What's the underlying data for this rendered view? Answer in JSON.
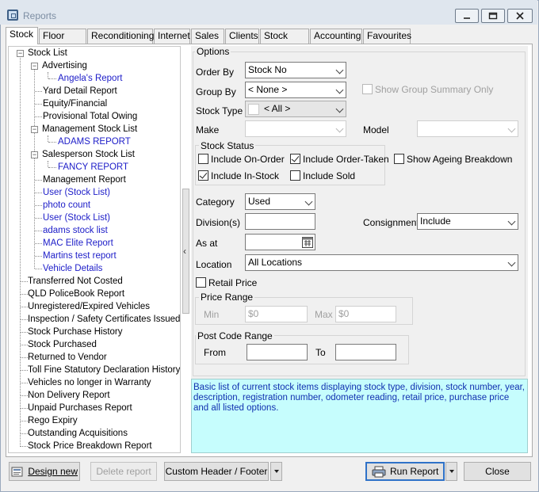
{
  "window": {
    "title": "Reports"
  },
  "tabs": [
    "Stock",
    "Floor Plan",
    "Reconditioning",
    "Internet",
    "Sales",
    "Clients",
    "Stock D/C",
    "Accounting",
    "Favourites"
  ],
  "tree": [
    {
      "label": "Stock List",
      "color": "#000"
    },
    {
      "label": "Advertising",
      "color": "#000"
    },
    {
      "label": "Angela's Report",
      "color": "#1c1cc8"
    },
    {
      "label": "Yard Detail Report",
      "color": "#000"
    },
    {
      "label": "Equity/Financial",
      "color": "#000"
    },
    {
      "label": "Provisional Total Owing",
      "color": "#000"
    },
    {
      "label": "Management Stock List",
      "color": "#000"
    },
    {
      "label": "ADAMS REPORT",
      "color": "#1c1cc8"
    },
    {
      "label": "Salesperson Stock List",
      "color": "#000"
    },
    {
      "label": "FANCY REPORT",
      "color": "#1c1cc8"
    },
    {
      "label": "Management Report",
      "color": "#000"
    },
    {
      "label": "User (Stock List)",
      "color": "#1c1cc8"
    },
    {
      "label": "photo count",
      "color": "#1c1cc8"
    },
    {
      "label": "User (Stock List)",
      "color": "#1c1cc8"
    },
    {
      "label": "adams stock list",
      "color": "#1c1cc8"
    },
    {
      "label": "MAC Elite Report",
      "color": "#1c1cc8"
    },
    {
      "label": "Martins test report",
      "color": "#1c1cc8"
    },
    {
      "label": "Vehicle Details",
      "color": "#1c1cc8"
    },
    {
      "label": "Transferred Not Costed",
      "color": "#000"
    },
    {
      "label": "QLD PoliceBook Report",
      "color": "#000"
    },
    {
      "label": "Unregistered/Expired Vehicles",
      "color": "#000"
    },
    {
      "label": "Inspection / Safety Certificates Issued",
      "color": "#000"
    },
    {
      "label": "Stock Purchase History",
      "color": "#000"
    },
    {
      "label": "Stock Purchased",
      "color": "#000"
    },
    {
      "label": "Returned to Vendor",
      "color": "#000"
    },
    {
      "label": "Toll Fine Statutory Declaration History",
      "color": "#000"
    },
    {
      "label": "Vehicles no longer in Warranty",
      "color": "#000"
    },
    {
      "label": "Non Delivery Report",
      "color": "#000"
    },
    {
      "label": "Unpaid Purchases Report",
      "color": "#000"
    },
    {
      "label": "Rego Expiry",
      "color": "#000"
    },
    {
      "label": "Outstanding Acquisitions",
      "color": "#000"
    },
    {
      "label": "Stock Price Breakdown Report",
      "color": "#000"
    }
  ],
  "options": {
    "group_title": "Options",
    "order_by": {
      "label": "Order By",
      "value": "Stock No"
    },
    "group_by": {
      "label": "Group By",
      "value": "< None >"
    },
    "show_group_summary": {
      "label": "Show Group Summary Only",
      "checked": false
    },
    "stock_type": {
      "label": "Stock Type",
      "value": "< All >"
    },
    "make": {
      "label": "Make",
      "value": ""
    },
    "model": {
      "label": "Model",
      "value": ""
    },
    "stock_status": {
      "title": "Stock Status",
      "include_on_order": {
        "label": "Include On-Order",
        "checked": false
      },
      "include_order_taken": {
        "label": "Include Order-Taken",
        "checked": true
      },
      "include_in_stock": {
        "label": "Include In-Stock",
        "checked": true
      },
      "include_sold": {
        "label": "Include Sold",
        "checked": false
      }
    },
    "show_ageing": {
      "label": "Show Ageing Breakdown",
      "checked": false
    },
    "category": {
      "label": "Category",
      "value": "Used"
    },
    "divisions": {
      "label": "Division(s)",
      "value": ""
    },
    "consignment": {
      "label": "Consignment",
      "value": "Include"
    },
    "as_at": {
      "label": "As at",
      "value": ""
    },
    "location": {
      "label": "Location",
      "value": "All Locations"
    },
    "retail_price": {
      "label": "Retail Price",
      "checked": false
    },
    "price_range": {
      "title": "Price Range",
      "min_label": "Min",
      "min_value": "$0",
      "max_label": "Max",
      "max_value": "$0"
    },
    "post_code_range": {
      "title": "Post Code Range",
      "from_label": "From",
      "from_value": "",
      "to_label": "To",
      "to_value": ""
    }
  },
  "description": "Basic list of current stock items displaying stock type, division, stock number, year, description, registration number, odometer reading, retail price, purchase price and all listed options.",
  "buttons": {
    "design_new": "Design new",
    "delete_report": "Delete report",
    "custom_header_footer": "Custom Header / Footer",
    "run_report": "Run Report",
    "close": "Close"
  },
  "colors": {
    "description_bg": "#c6fdfd",
    "link_blue": "#1c1cc8",
    "primary_border": "#2f72c8"
  }
}
